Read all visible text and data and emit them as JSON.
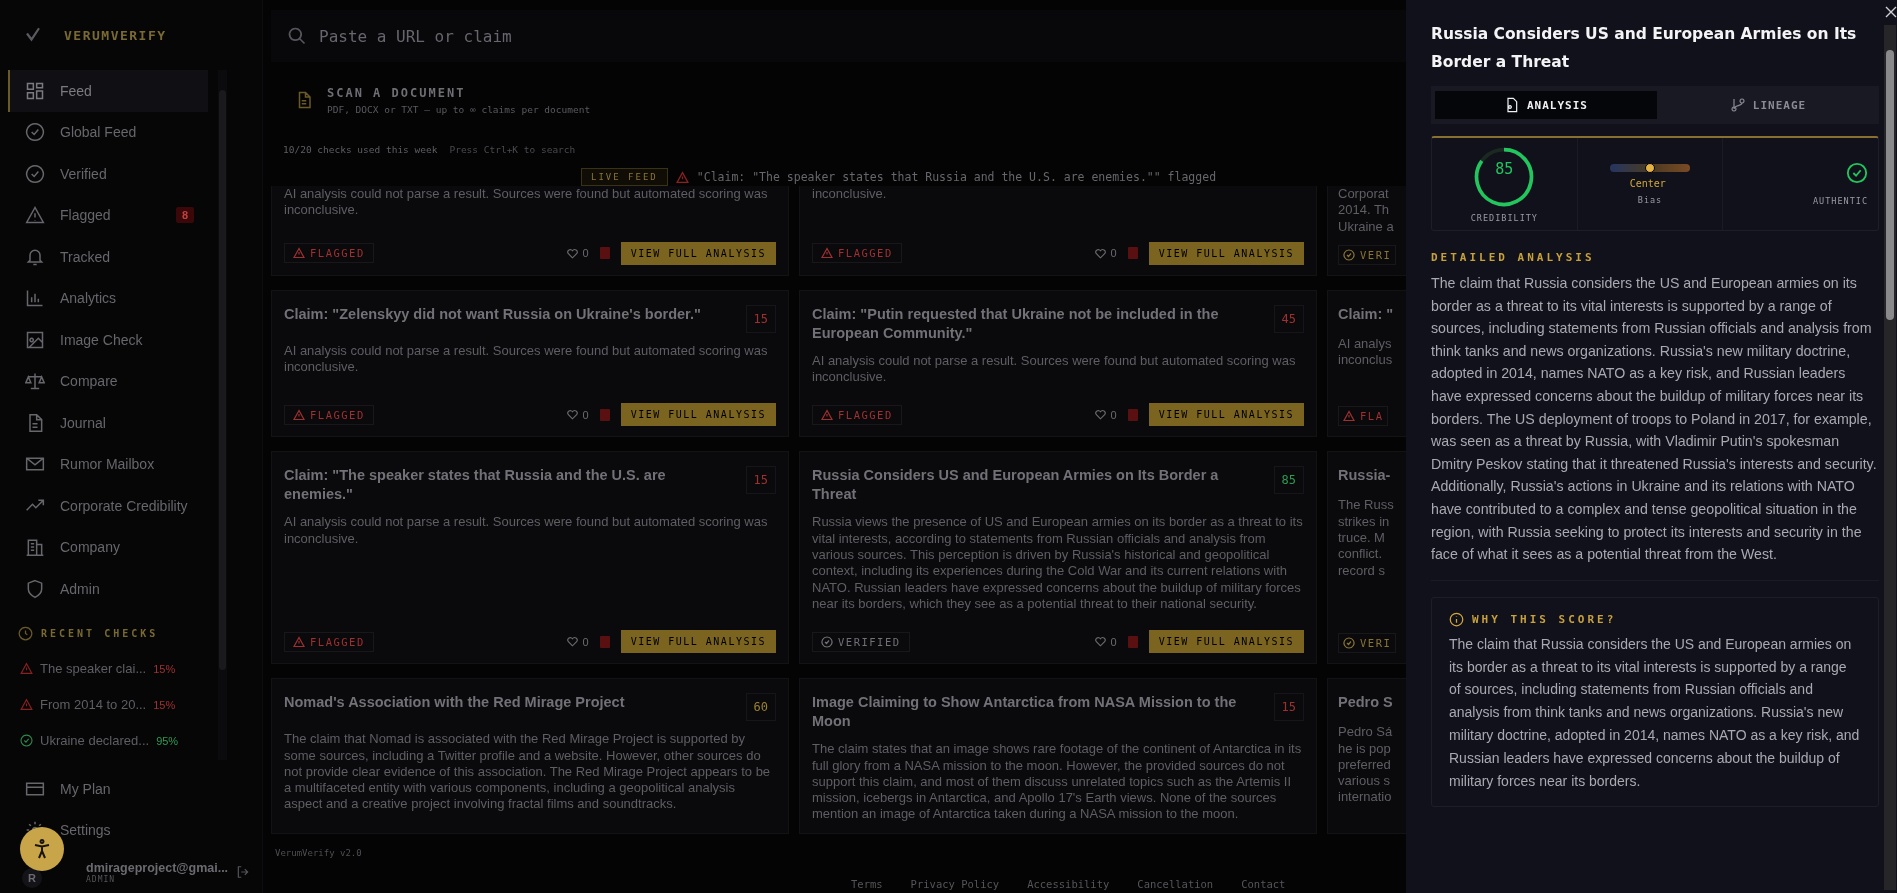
{
  "sidebar": {
    "brand": "VERUMVERIFY",
    "items": [
      {
        "label": "Feed",
        "selected": true
      },
      {
        "label": "Global Feed",
        "selected": false
      },
      {
        "label": "Verified",
        "selected": false
      },
      {
        "label": "Flagged",
        "selected": false,
        "badge": "8"
      },
      {
        "label": "Tracked",
        "selected": false
      },
      {
        "label": "Analytics",
        "selected": false
      },
      {
        "label": "Image Check",
        "selected": false
      },
      {
        "label": "Compare",
        "selected": false
      },
      {
        "label": "Journal",
        "selected": false
      },
      {
        "label": "Rumor Mailbox",
        "selected": false
      },
      {
        "label": "Corporate Credibility",
        "selected": false
      },
      {
        "label": "Company",
        "selected": false
      },
      {
        "label": "Admin",
        "selected": false
      }
    ],
    "recent_checks": {
      "title": "RECENT CHECKS",
      "items": [
        {
          "text": "The speaker clai...",
          "score": "15%",
          "kind": "flagged"
        },
        {
          "text": "From 2014 to 20...",
          "score": "15%",
          "kind": "flagged"
        },
        {
          "text": "Ukraine declared...",
          "score": "95%",
          "kind": "verified"
        }
      ]
    },
    "bottom_items": [
      {
        "label": "My Plan"
      },
      {
        "label": "Settings"
      }
    ],
    "user": {
      "avatar": "R",
      "email": "dmirageproject@gmai...",
      "role": "ADMIN"
    }
  },
  "search": {
    "placeholder": "Paste a URL or claim"
  },
  "scan": {
    "title": "SCAN A DOCUMENT",
    "subtitle": "PDF, DOCX or TXT — up to ∞ claims per document"
  },
  "usage": {
    "text": "10/20 checks used this week",
    "hint": "Press Ctrl+K to search"
  },
  "live_feed": {
    "badge": "LIVE FEED",
    "text": "\"Claim: \"The speaker states that Russia and the U.S. are enemies.\"\" flagged"
  },
  "feed_rows": [
    {
      "cards": [
        {
          "kind": "flagged",
          "body": "AI analysis could not parse a result. Sources were found but automated scoring was inconclusive.",
          "status_label": "FLAGGED",
          "likes": "0",
          "action": "VIEW FULL ANALYSIS"
        },
        {
          "kind": "flagged",
          "body": "inconclusive.",
          "status_label": "FLAGGED",
          "likes": "0",
          "action": "VIEW FULL ANALYSIS"
        }
      ],
      "edge": {
        "kind": "verified",
        "lines": [
          "Corporat",
          "2014. Th",
          "Ukraine a"
        ],
        "status_label": "VERI"
      }
    },
    {
      "cards": [
        {
          "kind": "flagged",
          "title": "Claim: \"Zelenskyy did not want Russia on Ukraine's border.\"",
          "score": "15",
          "body": "AI analysis could not parse a result. Sources were found but automated scoring was inconclusive.",
          "status_label": "FLAGGED",
          "likes": "0",
          "action": "VIEW FULL ANALYSIS"
        },
        {
          "kind": "flagged",
          "title": "Claim: \"Putin requested that Ukraine not be included in the European Community.\"",
          "score": "45",
          "body": "AI analysis could not parse a result. Sources were found but automated scoring was inconclusive.",
          "status_label": "FLAGGED",
          "likes": "0",
          "action": "VIEW FULL ANALYSIS"
        }
      ],
      "edge": {
        "kind": "flagged",
        "title": "Claim: \"",
        "lines": [
          "AI analys",
          "inconclus"
        ],
        "status_label": "FLA"
      }
    },
    {
      "cards": [
        {
          "kind": "flagged",
          "title": "Claim: \"The speaker states that Russia and the U.S. are enemies.\"",
          "score": "15",
          "body": "AI analysis could not parse a result. Sources were found but automated scoring was inconclusive.",
          "status_label": "FLAGGED",
          "likes": "0",
          "action": "VIEW FULL ANALYSIS"
        },
        {
          "kind": "verified",
          "title": "Russia Considers US and European Armies on Its Border a Threat",
          "score": "85",
          "body": "Russia views the presence of US and European armies on its border as a threat to its vital interests, according to statements from Russian officials and analysis from various sources. This perception is driven by Russia's historical and geopolitical context, including its experiences during the Cold War and its current relations with NATO. Russian leaders have expressed concerns about the buildup of military forces near its borders, which they see as a potential threat to their national security.",
          "status_label": "VERIFIED",
          "likes": "0",
          "action": "VIEW FULL ANALYSIS"
        }
      ],
      "edge": {
        "kind": "verified",
        "title": "Russia-",
        "lines": [
          "The Russ",
          "strikes in",
          "truce. M",
          "conflict.",
          "record s"
        ],
        "status_label": "VERI"
      }
    },
    {
      "cards": [
        {
          "kind": "mixed",
          "title": "Nomad's Association with the Red Mirage Project",
          "score": "60",
          "body": "The claim that Nomad is associated with the Red Mirage Project is supported by some sources, including a Twitter profile and a website. However, other sources do not provide clear evidence of this association. The Red Mirage Project appears to be a multifaceted entity with various components, including a geopolitical analysis aspect and a creative project involving fractal films and soundtracks."
        },
        {
          "kind": "flagged",
          "title": "Image Claiming to Show Antarctica from NASA Mission to the Moon",
          "score": "15",
          "body": "The claim states that an image shows rare footage of the continent of Antarctica in its full glory from a NASA mission to the moon. However, the provided sources do not support this claim, and most of them discuss unrelated topics such as the Artemis II mission, icebergs in Antarctica, and Apollo 17's Earth views. None of the sources mention an image of Antarctica taken during a NASA mission to the moon."
        }
      ],
      "edge": {
        "title": "Pedro S",
        "lines": [
          "Pedro Sá",
          "he is pop",
          "preferred",
          "various s",
          "internatio"
        ]
      }
    }
  ],
  "footer": {
    "version": "VerumVerify v2.0",
    "links": [
      "Terms",
      "Privacy Policy",
      "Accessibility",
      "Cancellation",
      "Contact"
    ]
  },
  "drawer": {
    "title": "Russia Considers US and European Armies on Its Border a Threat",
    "tabs": [
      {
        "label": "ANALYSIS",
        "selected": true
      },
      {
        "label": "LINEAGE",
        "selected": false
      }
    ],
    "credibility": {
      "value": "85",
      "label": "CREDIBILITY",
      "level": 0.85
    },
    "bias": {
      "reading": "Center",
      "label": "Bias",
      "level": 0.5
    },
    "authenticity": {
      "label": "AUTHENTIC"
    },
    "detailed_analysis": {
      "heading": "DETAILED ANALYSIS",
      "text": "The claim that Russia considers the US and European armies on its border as a threat to its vital interests is supported by a range of sources, including statements from Russian officials and analysis from think tanks and news organizations. Russia's new military doctrine, adopted in 2014, names NATO as a key risk, and Russian leaders have expressed concerns about the buildup of military forces near its borders. The US deployment of troops to Poland in 2017, for example, was seen as a threat by Russia, with Vladimir Putin's spokesman Dmitry Peskov stating that it threatened Russia's interests and security. Additionally, Russia's actions in Ukraine and its relations with NATO have contributed to a complex and tense geopolitical situation in the region, with Russia seeking to protect its interests and security in the face of what it sees as a potential threat from the West."
    },
    "why_score": {
      "heading": "WHY THIS SCORE?",
      "text": "The claim that Russia considers the US and European armies on its border as a threat to its vital interests is supported by a range of sources, including statements from Russian officials and analysis from think tanks and news organizations. Russia's new military doctrine, adopted in 2014, names NATO as a key risk, and Russian leaders have expressed concerns about the buildup of military forces near its borders."
    }
  }
}
